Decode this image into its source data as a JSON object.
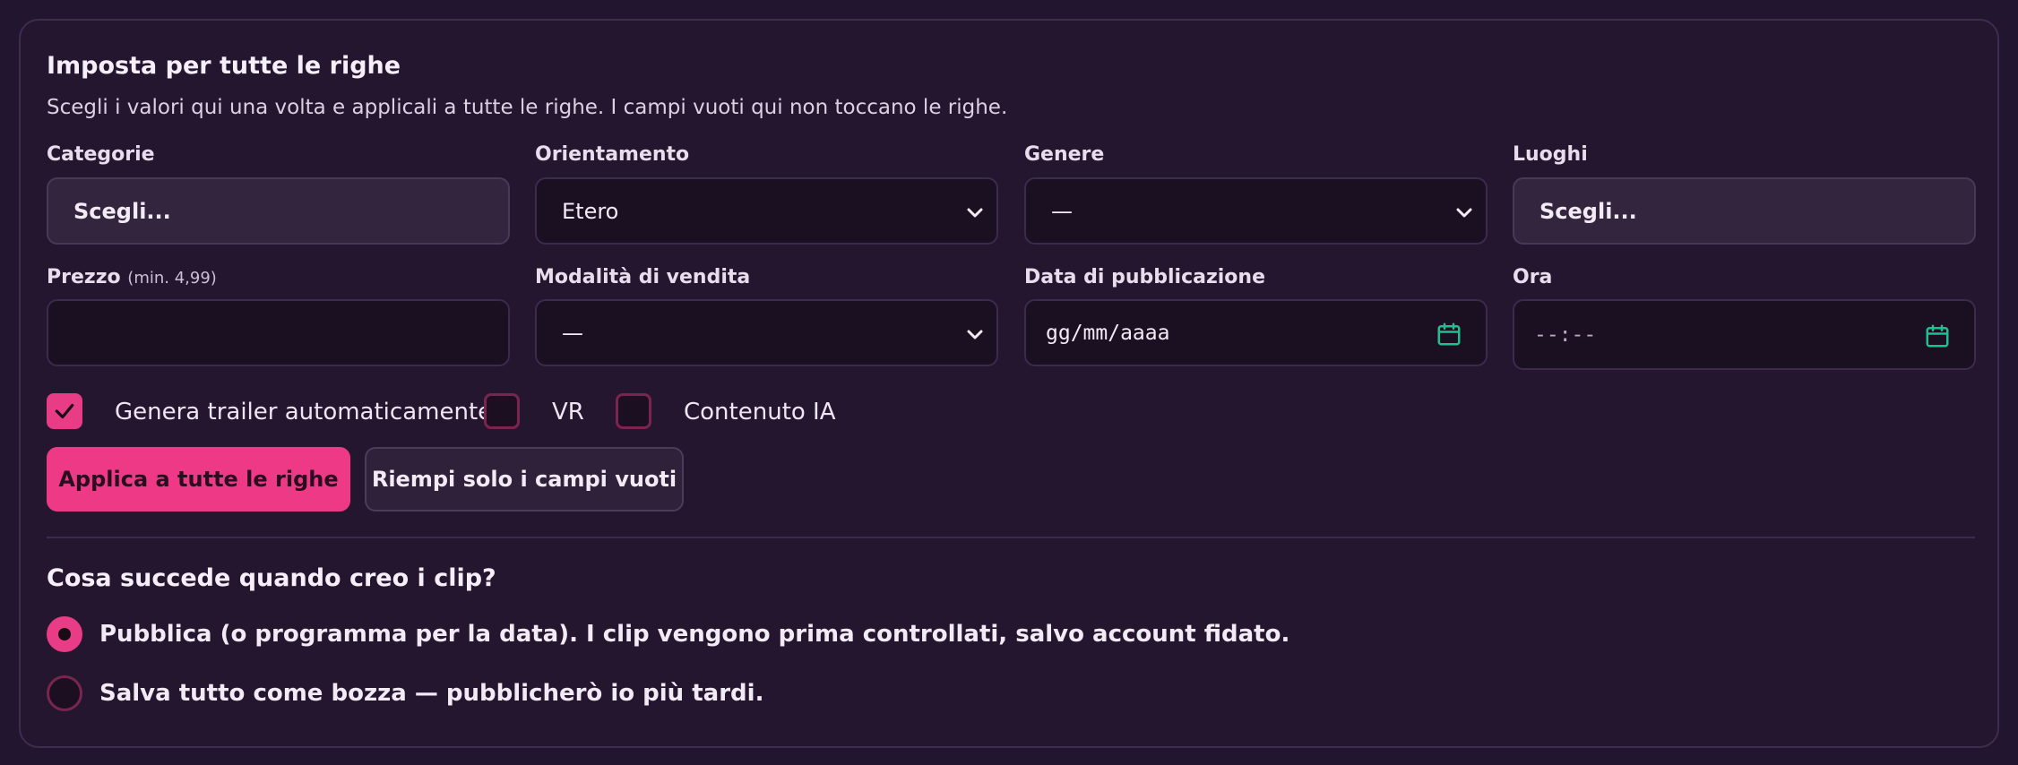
{
  "panel": {
    "title": "Imposta per tutte le righe",
    "subtitle": "Scegli i valori qui una volta e applicali a tutte le righe. I campi vuoti qui non toccano le righe."
  },
  "fields": {
    "categorie": {
      "label": "Categorie",
      "value": "Scegli..."
    },
    "orientamento": {
      "label": "Orientamento",
      "value": "Etero"
    },
    "genere": {
      "label": "Genere",
      "value": "—"
    },
    "luoghi": {
      "label": "Luoghi",
      "value": "Scegli..."
    },
    "prezzo": {
      "label": "Prezzo",
      "hint": "(min. 4,99)",
      "value": ""
    },
    "modalita": {
      "label": "Modalità di vendita",
      "value": "—"
    },
    "data": {
      "label": "Data di pubblicazione",
      "placeholder": "gg/mm/aaaa"
    },
    "ora": {
      "label": "Ora",
      "placeholder": "--:--"
    }
  },
  "checkboxes": [
    {
      "label": "Genera trailer automaticamente",
      "checked": true
    },
    {
      "label": "VR",
      "checked": false
    },
    {
      "label": "Contenuto IA",
      "checked": false
    }
  ],
  "buttons": {
    "apply_all": "Applica a tutte le righe",
    "fill_empty": "Riempi solo i campi vuoti"
  },
  "publish": {
    "title": "Cosa succede quando creo i clip?",
    "options": [
      {
        "label": "Pubblica (o programma per la data). I clip vengono prima controllati, salvo account fidato.",
        "selected": true
      },
      {
        "label": "Salva tutto come bozza — pubblicherò io più tardi.",
        "selected": false
      }
    ]
  },
  "colors": {
    "accent": "#ee3a86",
    "calendar_icon": "#1fbf8f",
    "background": "#221530"
  }
}
